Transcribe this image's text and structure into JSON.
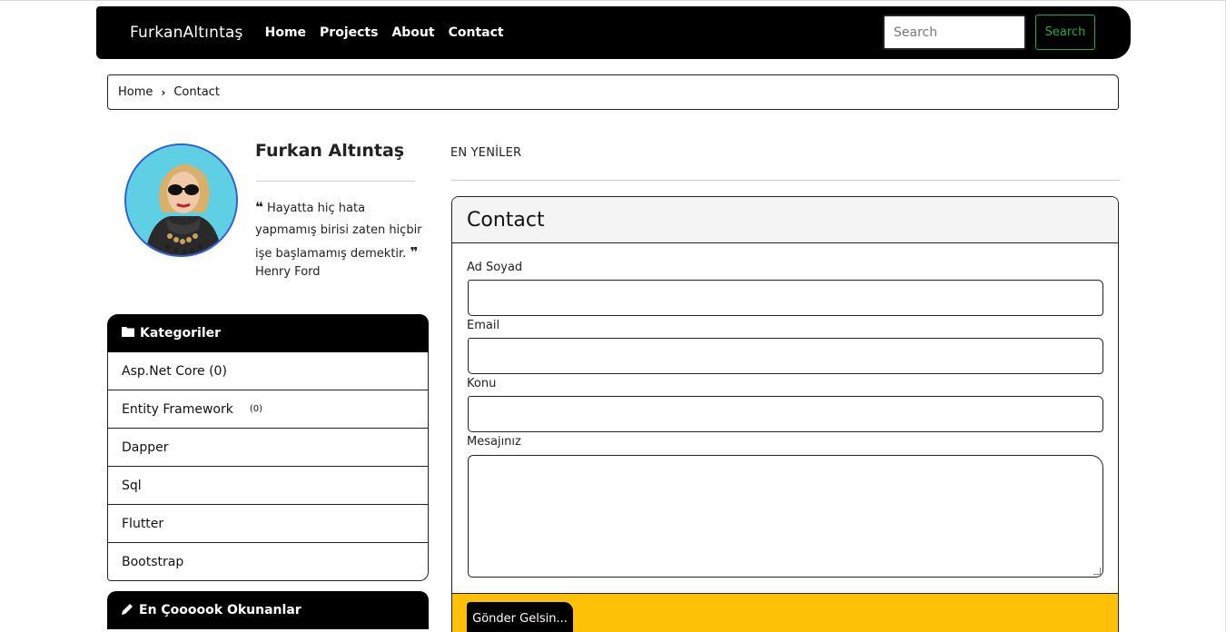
{
  "navbar": {
    "brand": "FurkanAltıntaş",
    "links": [
      "Home",
      "Projects",
      "About",
      "Contact"
    ],
    "search_placeholder": "Search",
    "search_button": "Search"
  },
  "breadcrumb": {
    "home": "Home",
    "separator": "›",
    "current": "Contact"
  },
  "profile": {
    "name": "Furkan Altıntaş",
    "quote_open": "❝",
    "quote_text": "Hayatta hiç hata yapmamış birisi zaten hiçbir işe başlamamış demektir.",
    "quote_close": "❞",
    "quote_author": "Henry Ford"
  },
  "categories": {
    "header": "Kategoriler",
    "icon": "folder-icon",
    "items": [
      {
        "label": "Asp.Net Core (0)",
        "count": ""
      },
      {
        "label": "Entity Framework",
        "count": "(0)"
      },
      {
        "label": "Dapper",
        "count": ""
      },
      {
        "label": "Sql",
        "count": ""
      },
      {
        "label": "Flutter",
        "count": ""
      },
      {
        "label": "Bootstrap",
        "count": ""
      }
    ]
  },
  "popular": {
    "header": "En Çoooook Okunanlar",
    "icon": "pencil-icon"
  },
  "main": {
    "section_title": "EN YENİLER",
    "card_title": "Contact",
    "fields": {
      "name_label": "Ad Soyad",
      "email_label": "Email",
      "subject_label": "Konu",
      "message_label": "Mesajınız"
    },
    "submit_label": "Gönder Gelsin..."
  },
  "colors": {
    "navbar_bg": "#000000",
    "search_button": "#28a745",
    "card_footer": "#ffc107",
    "avatar_border": "#2e5fd8"
  }
}
